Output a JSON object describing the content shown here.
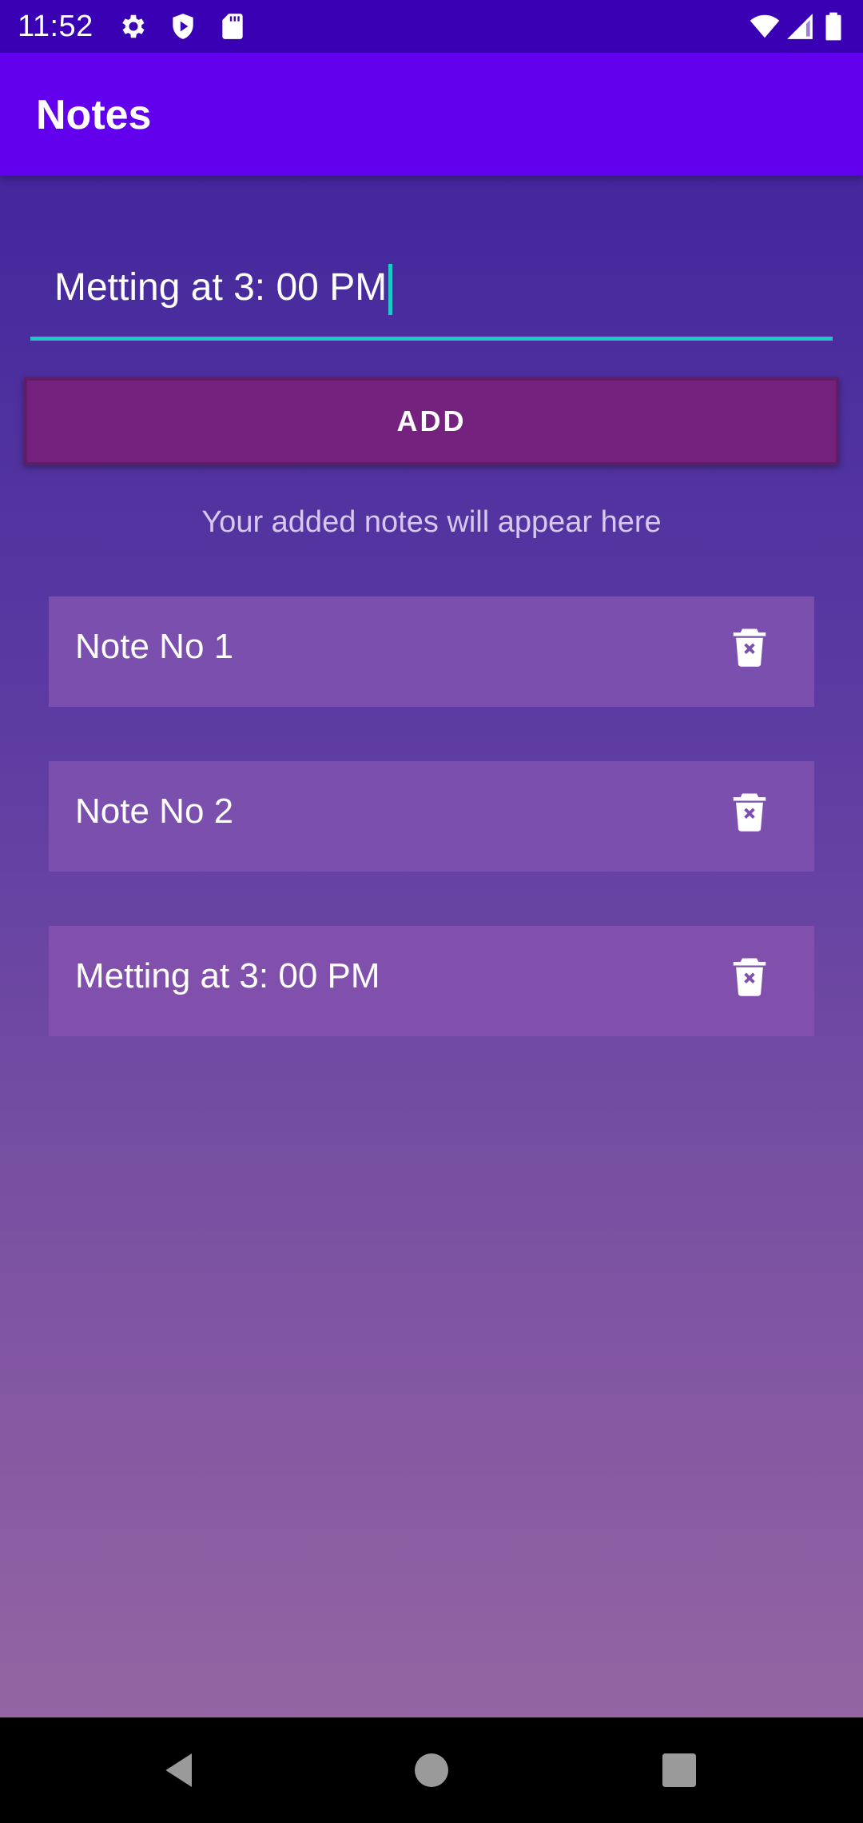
{
  "status_bar": {
    "time": "11:52",
    "icons": [
      "gear-icon",
      "shield-icon",
      "sd-card-icon",
      "wifi-icon",
      "signal-icon",
      "battery-icon"
    ]
  },
  "app_bar": {
    "title": "Notes"
  },
  "input": {
    "value": "Metting at 3: 00 PM",
    "accent_color": "#1fc9c9"
  },
  "add_button": {
    "label": "ADD",
    "color": "#74227e"
  },
  "hint": "Your added notes will appear here",
  "notes": [
    {
      "text": "Note No 1",
      "icon": "delete-icon"
    },
    {
      "text": "Note No 2",
      "icon": "delete-icon"
    },
    {
      "text": "Metting at 3: 00 PM",
      "icon": "delete-icon"
    }
  ],
  "nav_bar": {
    "icons": [
      "back-icon",
      "home-icon",
      "recents-icon"
    ]
  },
  "colors": {
    "status_bar": "#3a00b4",
    "app_bar": "#6200ee",
    "card": "#7b4fae"
  }
}
